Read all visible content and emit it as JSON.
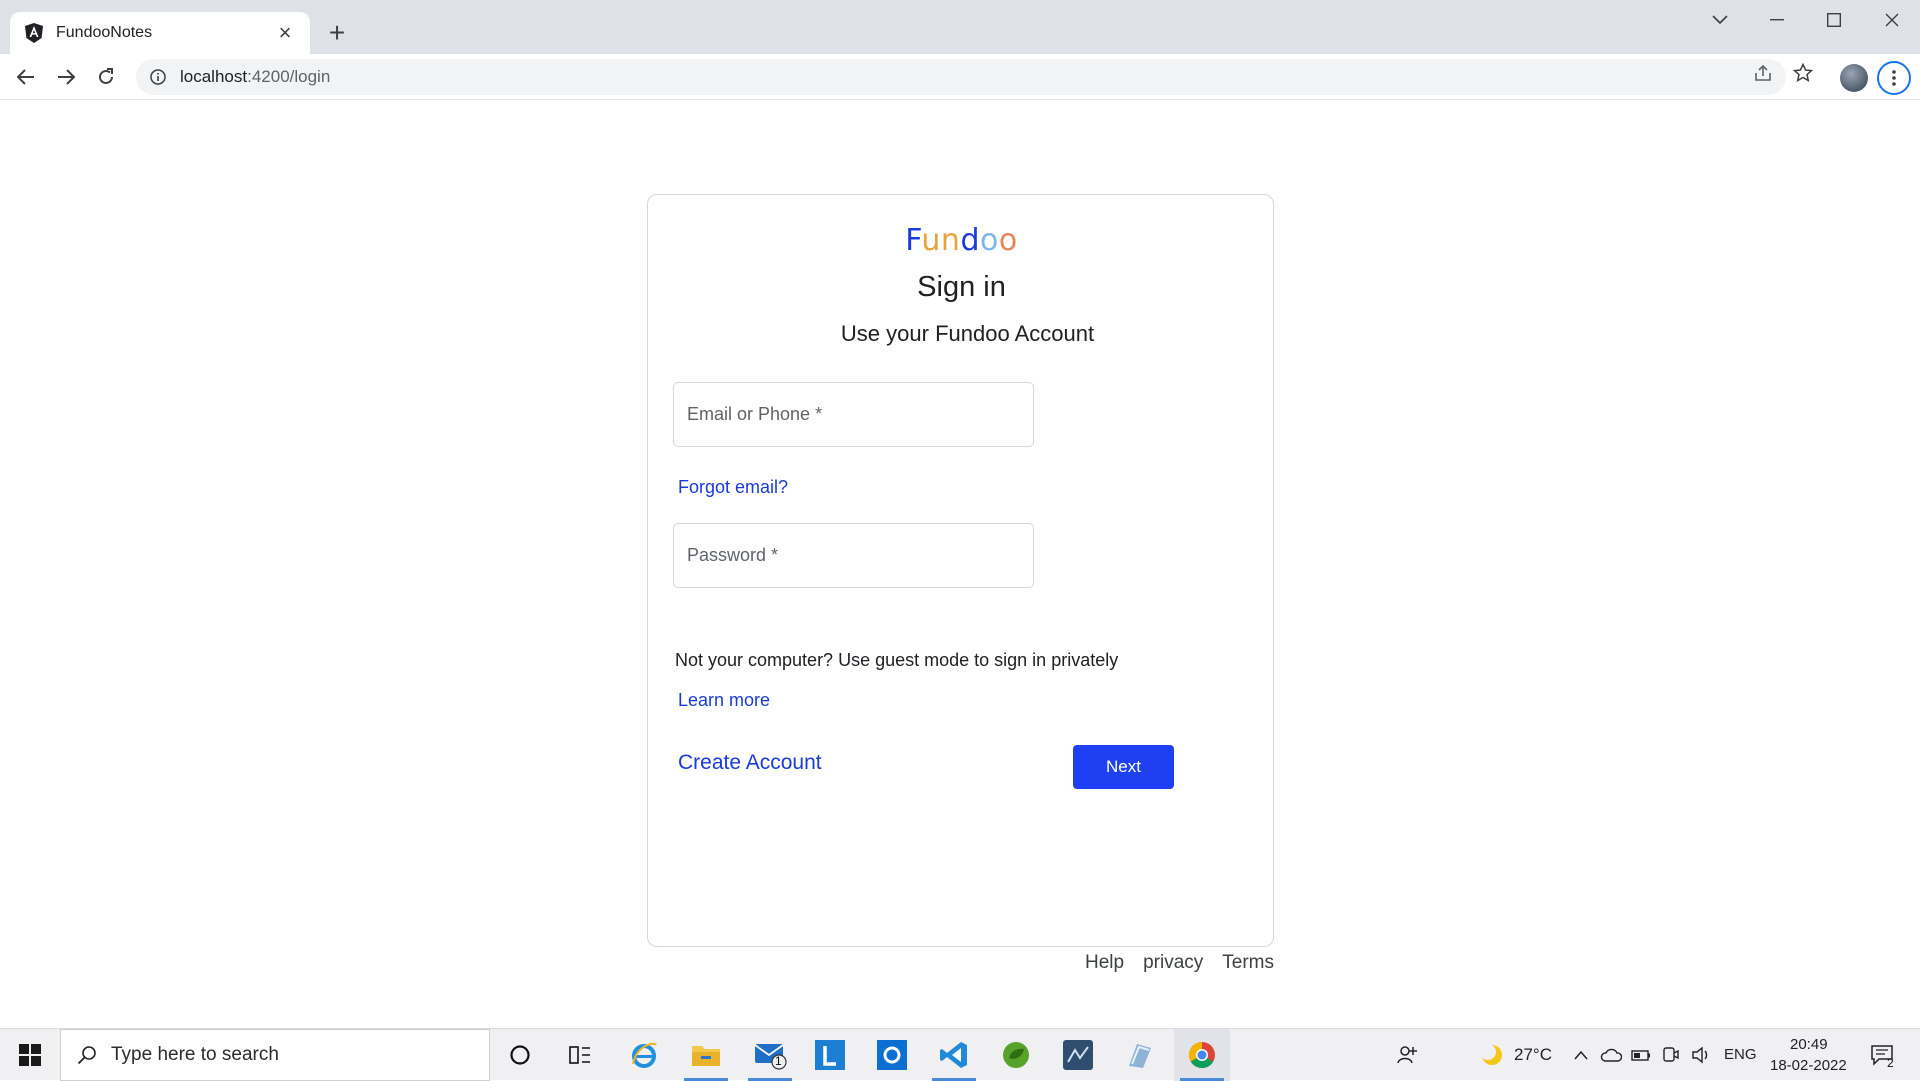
{
  "browser": {
    "tab_title": "FundooNotes",
    "url_host": "localhost",
    "url_rest": ":4200/login"
  },
  "login": {
    "logo_letters": [
      {
        "ch": "F",
        "color": "#1a3bd8"
      },
      {
        "ch": "u",
        "color": "#e8a33d"
      },
      {
        "ch": "n",
        "color": "#e8a33d"
      },
      {
        "ch": "d",
        "color": "#1a3bd8"
      },
      {
        "ch": "o",
        "color": "#7fb6e8"
      },
      {
        "ch": "o",
        "color": "#e8845a"
      }
    ],
    "title": "Sign in",
    "subtitle": "Use your Fundoo Account",
    "email_placeholder": "Email or Phone *",
    "forgot_email": "Forgot email?",
    "password_placeholder": "Password *",
    "guest_notice": "Not your computer? Use guest mode to sign in privately",
    "learn_more": "Learn more",
    "create_account": "Create Account",
    "next": "Next"
  },
  "footer": {
    "help": "Help",
    "privacy": "privacy",
    "terms": "Terms"
  },
  "taskbar": {
    "search_placeholder": "Type here to search",
    "mail_badge": "1",
    "weather": "27°C",
    "language": "ENG",
    "time": "20:49",
    "date": "18-02-2022",
    "notification_count": "2"
  },
  "colors": {
    "accent": "#1e3ff2",
    "link": "#1a3bd8"
  }
}
